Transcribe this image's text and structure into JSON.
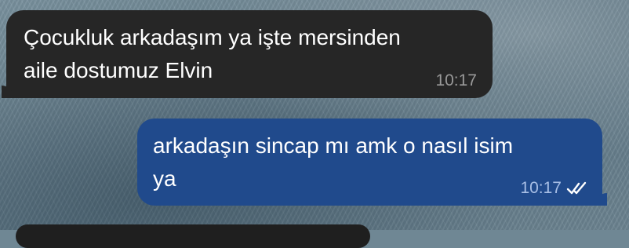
{
  "messages": [
    {
      "direction": "incoming",
      "text": "Çocukluk arkadaşım ya işte mersinden\naile dostumuz Elvin",
      "time": "10:17"
    },
    {
      "direction": "outgoing",
      "text": "arkadaşın sincap mı amk o nasıl isim\nya",
      "time": "10:17",
      "status_icon": "double-check-icon"
    }
  ],
  "colors": {
    "incoming_bubble": "#262626",
    "outgoing_bubble": "#204a8c",
    "text": "#ffffff",
    "incoming_time": "#9a9a9a",
    "outgoing_time": "#a8bfe6"
  }
}
